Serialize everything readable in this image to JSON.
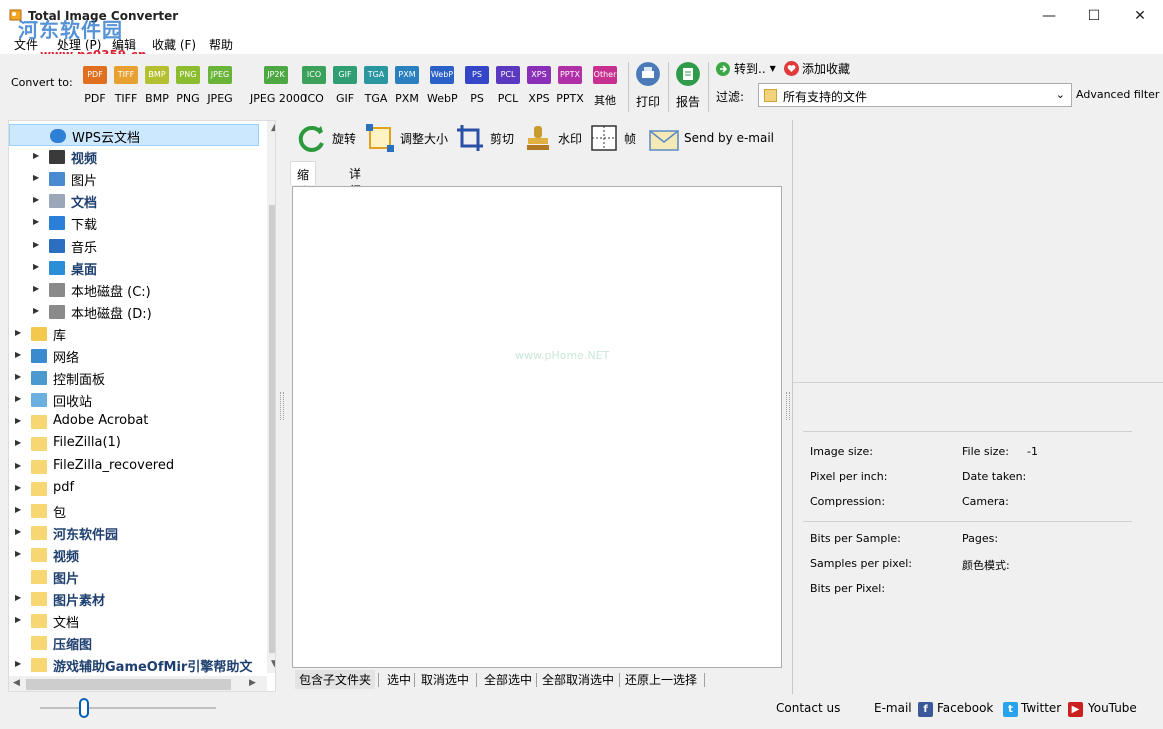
{
  "window": {
    "title": "Total Image Converter",
    "watermark": "河东软件园",
    "watermark_url": "www.pc0359.cn",
    "controls": {
      "minimize": "—",
      "maximize": "☐",
      "close": "✕"
    }
  },
  "menu": [
    "文件",
    "处理 (P)",
    "编辑",
    "收藏 (F)",
    "帮助"
  ],
  "toolbar": {
    "convert_to": "Convert to:",
    "formats": [
      {
        "label": "PDF",
        "badge": "PDF",
        "color": "#e07020"
      },
      {
        "label": "TIFF",
        "badge": "TIFF",
        "color": "#e8a030"
      },
      {
        "label": "BMP",
        "badge": "BMP",
        "color": "#b5c030"
      },
      {
        "label": "PNG",
        "badge": "PNG",
        "color": "#8cbd2e"
      },
      {
        "label": "JPEG",
        "badge": "JPEG",
        "color": "#6ab43a"
      },
      {
        "label": "JPEG 2000",
        "badge": "JP2K",
        "color": "#4da843"
      },
      {
        "label": "ICO",
        "badge": "ICO",
        "color": "#3aa05a"
      },
      {
        "label": "GIF",
        "badge": "GIF",
        "color": "#2f9e72"
      },
      {
        "label": "TGA",
        "badge": "TGA",
        "color": "#2a96a0"
      },
      {
        "label": "PXM",
        "badge": "PXM",
        "color": "#2a7fbf"
      },
      {
        "label": "WebP",
        "badge": "WebP",
        "color": "#2a60c8"
      },
      {
        "label": "PS",
        "badge": "PS",
        "color": "#3545c8"
      },
      {
        "label": "PCL",
        "badge": "PCL",
        "color": "#5a38c0"
      },
      {
        "label": "XPS",
        "badge": "XPS",
        "color": "#8a30b8"
      },
      {
        "label": "PPTX",
        "badge": "PPTX",
        "color": "#b030a8"
      },
      {
        "label": "其他",
        "badge": "Other",
        "color": "#c83090"
      }
    ],
    "print": "打印",
    "report": "报告",
    "goto": "转到..",
    "add_favorite": "添加收藏",
    "filter_label": "过滤:",
    "filter_value": "所有支持的文件",
    "advanced_filter": "Advanced filter"
  },
  "tree": [
    {
      "label": "WPS云文档",
      "icon": "cloud-icon",
      "selected": true,
      "bold": false
    },
    {
      "label": "视频",
      "icon": "video-icon",
      "bold": true
    },
    {
      "label": "图片",
      "icon": "pictures-icon",
      "bold": false
    },
    {
      "label": "文档",
      "icon": "document-icon",
      "bold": true
    },
    {
      "label": "下载",
      "icon": "download-icon",
      "bold": false
    },
    {
      "label": "音乐",
      "icon": "music-icon",
      "bold": false
    },
    {
      "label": "桌面",
      "icon": "desktop-icon",
      "bold": true
    },
    {
      "label": "本地磁盘 (C:)",
      "icon": "drive-icon",
      "bold": false
    },
    {
      "label": "本地磁盘 (D:)",
      "icon": "drive-icon",
      "bold": false
    },
    {
      "label": "库",
      "icon": "library-icon",
      "bold": false
    },
    {
      "label": "网络",
      "icon": "network-icon",
      "bold": false
    },
    {
      "label": "控制面板",
      "icon": "control-panel-icon",
      "bold": false
    },
    {
      "label": "回收站",
      "icon": "recycle-bin-icon",
      "bold": false
    },
    {
      "label": "Adobe Acrobat",
      "icon": "folder-icon",
      "bold": false
    },
    {
      "label": "FileZilla(1)",
      "icon": "folder-icon",
      "bold": false
    },
    {
      "label": "FileZilla_recovered",
      "icon": "folder-icon",
      "bold": false
    },
    {
      "label": "pdf",
      "icon": "folder-icon",
      "bold": false
    },
    {
      "label": "包",
      "icon": "folder-icon",
      "bold": false
    },
    {
      "label": "河东软件园",
      "icon": "folder-icon",
      "bold": true
    },
    {
      "label": "视频",
      "icon": "folder-icon",
      "bold": true
    },
    {
      "label": "图片",
      "icon": "folder-icon",
      "bold": true
    },
    {
      "label": "图片素材",
      "icon": "folder-icon",
      "bold": true
    },
    {
      "label": "文档",
      "icon": "folder-icon",
      "bold": false
    },
    {
      "label": "压缩图",
      "icon": "folder-icon",
      "bold": true
    },
    {
      "label": "游戏辅助GameOfMir引擎帮助文",
      "icon": "folder-icon",
      "bold": true
    }
  ],
  "actions": {
    "rotate": "旋转",
    "resize": "调整大小",
    "crop": "剪切",
    "watermark": "水印",
    "frame": "帧",
    "send_email": "Send by e-mail"
  },
  "tabs": [
    "缩略图",
    "详细信息"
  ],
  "thumb_watermark": "www.pHome.NET",
  "bottom_links": [
    "包含子文件夹",
    "选中",
    "取消选中",
    "全部选中",
    "全部取消选中",
    "还原上一选择"
  ],
  "info": {
    "image_size": "Image size:",
    "file_size": "File size:",
    "file_size_value": "-1",
    "pixel_per_inch": "Pixel per inch:",
    "date_taken": "Date taken:",
    "compression": "Compression:",
    "camera": "Camera:",
    "bits_per_sample": "Bits per Sample:",
    "pages": "Pages:",
    "samples_per_pixel": "Samples per pixel:",
    "color_mode": "颜色模式:",
    "bits_per_pixel": "Bits per Pixel:"
  },
  "status": {
    "contact": "Contact us",
    "email": "E-mail",
    "facebook": "Facebook",
    "twitter": "Twitter",
    "youtube": "YouTube"
  }
}
